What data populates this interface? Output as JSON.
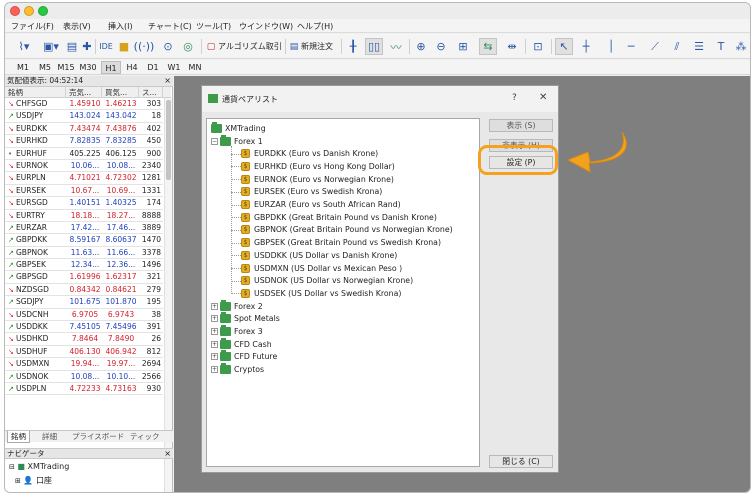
{
  "menu": [
    "ファイル(F)",
    "表示(V)",
    "挿入(I)",
    "チャート(C)",
    "ツール(T)",
    "ウインドウ(W)",
    "ヘルプ(H)"
  ],
  "toolbar": {
    "ide_label": "IDE",
    "algo_label": "アルゴリズム取引",
    "new_order_label": "新規注文"
  },
  "timeframes": [
    "M1",
    "M5",
    "M15",
    "M30",
    "H1",
    "H4",
    "D1",
    "W1",
    "MN"
  ],
  "active_timeframe": "H1",
  "market_watch": {
    "title": "気配値表示: 04:52:14",
    "columns": [
      "銘柄",
      "売気...",
      "買気...",
      "ス..."
    ],
    "rows": [
      {
        "dir": "down",
        "symbol": "CHFSGD",
        "bid": "1.45910",
        "ask": "1.46213",
        "spread": "303",
        "color": "red"
      },
      {
        "dir": "up",
        "symbol": "USDJPY",
        "bid": "143.024",
        "ask": "143.042",
        "spread": "18",
        "color": "blue"
      },
      {
        "dir": "down",
        "symbol": "EURDKK",
        "bid": "7.43474",
        "ask": "7.43876",
        "spread": "402",
        "color": "red"
      },
      {
        "dir": "down",
        "symbol": "EURHKD",
        "bid": "7.82835",
        "ask": "7.83285",
        "spread": "450",
        "color": "blue"
      },
      {
        "dir": "flat",
        "symbol": "EURHUF",
        "bid": "405.225",
        "ask": "406.125",
        "spread": "900",
        "color": "black"
      },
      {
        "dir": "down",
        "symbol": "EURNOK",
        "bid": "10.06...",
        "ask": "10.08...",
        "spread": "2340",
        "color": "blue"
      },
      {
        "dir": "down",
        "symbol": "EURPLN",
        "bid": "4.71021",
        "ask": "4.72302",
        "spread": "1281",
        "color": "red"
      },
      {
        "dir": "down",
        "symbol": "EURSEK",
        "bid": "10.67...",
        "ask": "10.69...",
        "spread": "1331",
        "color": "red"
      },
      {
        "dir": "down",
        "symbol": "EURSGD",
        "bid": "1.40151",
        "ask": "1.40325",
        "spread": "174",
        "color": "blue"
      },
      {
        "dir": "down",
        "symbol": "EURTRY",
        "bid": "18.18...",
        "ask": "18.27...",
        "spread": "8888",
        "color": "red"
      },
      {
        "dir": "up",
        "symbol": "EURZAR",
        "bid": "17.42...",
        "ask": "17.46...",
        "spread": "3889",
        "color": "blue"
      },
      {
        "dir": "up",
        "symbol": "GBPDKK",
        "bid": "8.59167",
        "ask": "8.60637",
        "spread": "1470",
        "color": "blue"
      },
      {
        "dir": "up",
        "symbol": "GBPNOK",
        "bid": "11.63...",
        "ask": "11.66...",
        "spread": "3378",
        "color": "blue"
      },
      {
        "dir": "up",
        "symbol": "GBPSEK",
        "bid": "12.34...",
        "ask": "12.36...",
        "spread": "1496",
        "color": "blue"
      },
      {
        "dir": "up",
        "symbol": "GBPSGD",
        "bid": "1.61996",
        "ask": "1.62317",
        "spread": "321",
        "color": "red"
      },
      {
        "dir": "down",
        "symbol": "NZDSGD",
        "bid": "0.84342",
        "ask": "0.84621",
        "spread": "279",
        "color": "red"
      },
      {
        "dir": "up",
        "symbol": "SGDJPY",
        "bid": "101.675",
        "ask": "101.870",
        "spread": "195",
        "color": "blue"
      },
      {
        "dir": "down",
        "symbol": "USDCNH",
        "bid": "6.9705",
        "ask": "6.9743",
        "spread": "38",
        "color": "red"
      },
      {
        "dir": "up",
        "symbol": "USDDKK",
        "bid": "7.45105",
        "ask": "7.45496",
        "spread": "391",
        "color": "blue"
      },
      {
        "dir": "down",
        "symbol": "USDHKD",
        "bid": "7.8464",
        "ask": "7.8490",
        "spread": "26",
        "color": "red"
      },
      {
        "dir": "down",
        "symbol": "USDHUF",
        "bid": "406.130",
        "ask": "406.942",
        "spread": "812",
        "color": "red"
      },
      {
        "dir": "down",
        "symbol": "USDMXN",
        "bid": "19.94...",
        "ask": "19.97...",
        "spread": "2694",
        "color": "red"
      },
      {
        "dir": "up",
        "symbol": "USDNOK",
        "bid": "10.08...",
        "ask": "10.10...",
        "spread": "2566",
        "color": "blue"
      },
      {
        "dir": "up",
        "symbol": "USDPLN",
        "bid": "4.72233",
        "ask": "4.73163",
        "spread": "930",
        "color": "red"
      }
    ],
    "tabs": [
      "銘柄",
      "詳細",
      "プライスボード",
      "ティック"
    ]
  },
  "navigator": {
    "title": "ナビゲータ",
    "items": [
      "XMTrading",
      "口座"
    ]
  },
  "dialog": {
    "title": "通貨ペアリスト",
    "help": "?",
    "close": "✕",
    "tree": {
      "root": "XMTrading",
      "groups": [
        {
          "name": "Forex 1",
          "expanded": true,
          "items": [
            "EURDKK  (Euro vs Danish Krone)",
            "EURHKD  (Euro vs Hong Kong Dollar)",
            "EURNOK  (Euro vs Norwegian Krone)",
            "EURSEK  (Euro vs Swedish Krona)",
            "EURZAR  (Euro vs South African Rand)",
            "GBPDKK  (Great Britain Pound vs Danish Krone)",
            "GBPNOK  (Great Britain Pound vs Norwegian Krone)",
            "GBPSEK  (Great Britain Pound vs Swedish Krona)",
            "USDDKK  (US Dollar vs Danish Krone)",
            "USDMXN  (US Dollar vs Mexican Peso )",
            "USDNOK  (US Dollar vs Norwegian Krone)",
            "USDSEK  (US Dollar vs Swedish Krona)"
          ]
        },
        {
          "name": "Forex 2",
          "expanded": false
        },
        {
          "name": "Spot Metals",
          "expanded": false
        },
        {
          "name": "Forex 3",
          "expanded": false
        },
        {
          "name": "CFD Cash",
          "expanded": false
        },
        {
          "name": "CFD Future",
          "expanded": false
        },
        {
          "name": "Cryptos",
          "expanded": false
        }
      ]
    },
    "buttons": {
      "show": "表示 (S)",
      "hide": "非表示 (H)",
      "settings": "設定 (P)",
      "close": "閉じる (C)"
    }
  },
  "colors": {
    "bid_red": "#d2202a",
    "bid_blue": "#1f3fbf",
    "arrow_up": "#2a8a2a",
    "arrow_down": "#d2202a",
    "highlight": "#f2a21e"
  }
}
